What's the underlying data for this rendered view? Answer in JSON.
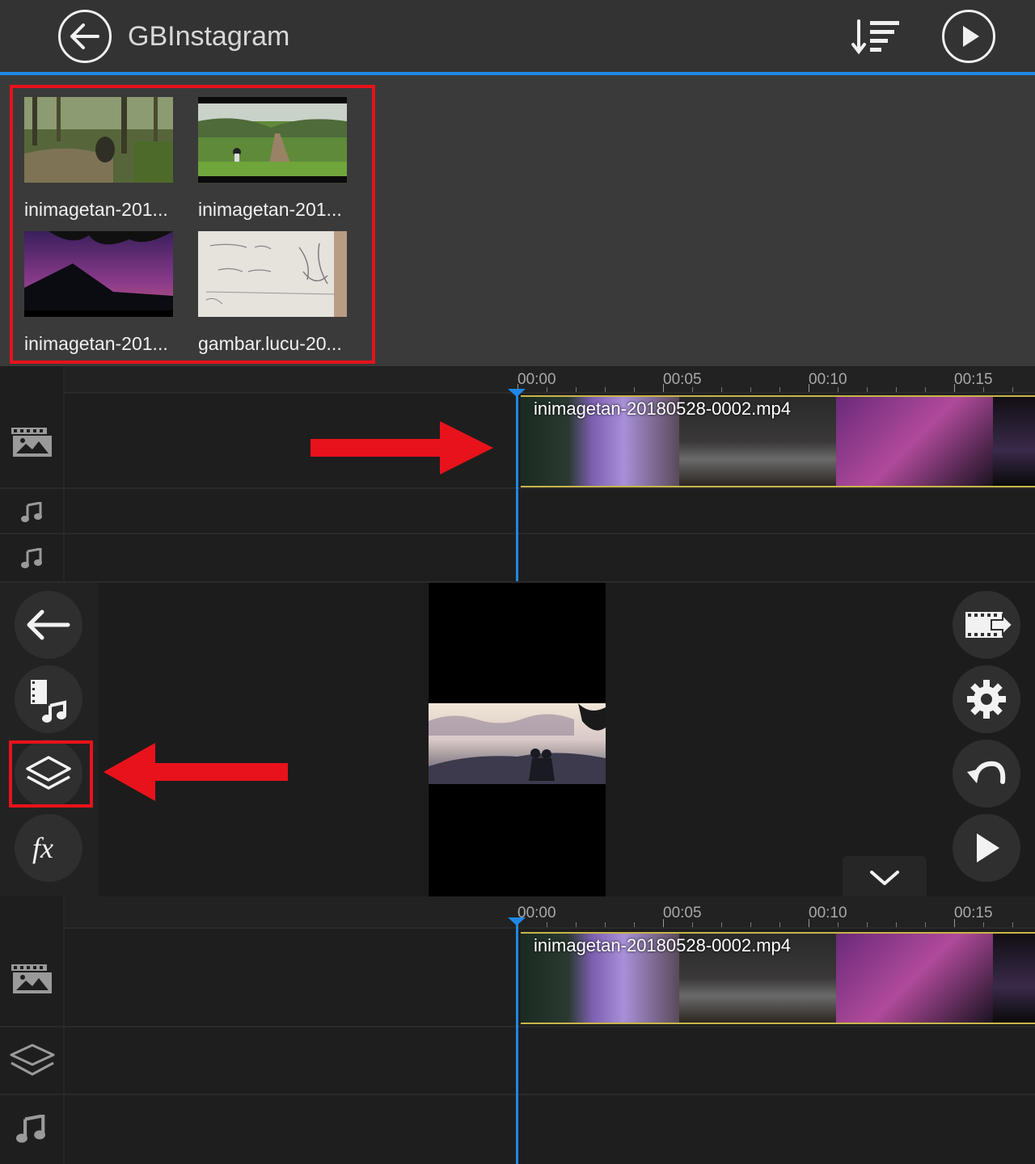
{
  "header": {
    "title": "GBInstagram",
    "back_icon": "back-arrow-icon",
    "sort_icon": "sort-icon",
    "play_icon": "play-icon"
  },
  "media_browser": {
    "items": [
      {
        "label": "inimagetan-201..."
      },
      {
        "label": "inimagetan-201..."
      },
      {
        "label": "inimagetan-201..."
      },
      {
        "label": "gambar.lucu-20..."
      }
    ]
  },
  "timeline_top": {
    "ruler": [
      "00:00",
      "00:05",
      "00:10",
      "00:15"
    ],
    "clip_name": "inimagetan-20180528-0002.mp4",
    "tracks": [
      "video-track",
      "audio-track",
      "audio-track"
    ]
  },
  "left_toolbar": {
    "buttons": [
      "back-arrow-icon",
      "media-music-icon",
      "layers-icon",
      "fx-icon"
    ]
  },
  "right_toolbar": {
    "buttons": [
      "export-icon",
      "settings-gear-icon",
      "undo-icon",
      "play-icon"
    ]
  },
  "timeline_bottom": {
    "ruler": [
      "00:00",
      "00:05",
      "00:10",
      "00:15"
    ],
    "clip_name": "inimagetan-20180528-0002.mp4",
    "tracks": [
      "video-track",
      "layer-track",
      "audio-track"
    ]
  },
  "colors": {
    "accent": "#1e88e5",
    "highlight": "#e8121b",
    "clip_border": "#c9b54a"
  }
}
